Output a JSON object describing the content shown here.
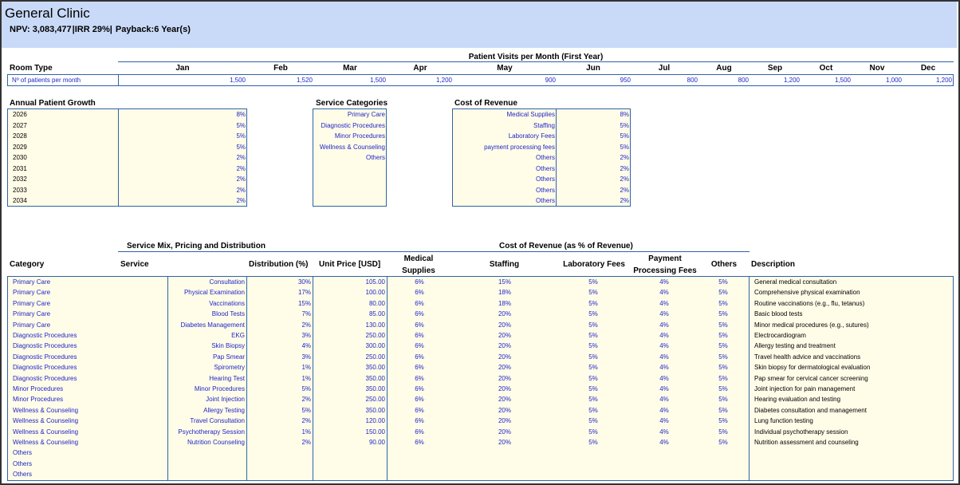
{
  "header": {
    "title": "General Clinic",
    "npv": "NPV: 3,083,477",
    "irr": "|IRR 29%|",
    "payback": "Payback:6 Year(s)"
  },
  "visits": {
    "section_title": "Patient Visits per Month (First Year)",
    "room_type_label": "Room Type",
    "row_label": "Nº of patients per month",
    "months": [
      "Jan",
      "Feb",
      "Mar",
      "Apr",
      "May",
      "Jun",
      "Jul",
      "Aug",
      "Sep",
      "Oct",
      "Nov",
      "Dec"
    ],
    "values": [
      "1,500",
      "1,520",
      "1,500",
      "1,200",
      "900",
      "950",
      "800",
      "800",
      "1,200",
      "1,500",
      "1,000",
      "1,200"
    ]
  },
  "growth": {
    "title": "Annual Patient Growth",
    "rows": [
      {
        "year": "2026",
        "value": "8%"
      },
      {
        "year": "2027",
        "value": "5%"
      },
      {
        "year": "2028",
        "value": "5%"
      },
      {
        "year": "2029",
        "value": "5%"
      },
      {
        "year": "2030",
        "value": "2%"
      },
      {
        "year": "2031",
        "value": "2%"
      },
      {
        "year": "2032",
        "value": "2%"
      },
      {
        "year": "2033",
        "value": "2%"
      },
      {
        "year": "2034",
        "value": "2%"
      }
    ]
  },
  "service_categories": {
    "title": "Service Categories",
    "items": [
      "Primary Care",
      "Diagnostic Procedures",
      "Minor Procedures",
      "Wellness & Counseling",
      "Others"
    ]
  },
  "cost_of_revenue": {
    "title": "Cost of Revenue",
    "rows": [
      {
        "label": "Medical Supplies",
        "value": "8%"
      },
      {
        "label": "Staffing",
        "value": "5%"
      },
      {
        "label": "Laboratory Fees",
        "value": "5%"
      },
      {
        "label": "payment processing fees",
        "value": "5%"
      },
      {
        "label": "Others",
        "value": "2%"
      },
      {
        "label": "Others",
        "value": "2%"
      },
      {
        "label": "Others",
        "value": "2%"
      },
      {
        "label": "Others",
        "value": "2%"
      },
      {
        "label": "Others",
        "value": "2%"
      }
    ]
  },
  "mix": {
    "group1_title": "Service Mix, Pricing and Distribution",
    "group2_title": "Cost of Revenue (as % of Revenue)",
    "headers": {
      "category": "Category",
      "service": "Service",
      "distribution": "Distribution (%)",
      "unit_price": "Unit Price [USD]",
      "medical_1": "Medical",
      "medical_2": "Supplies",
      "staffing": "Staffing",
      "lab": "Laboratory Fees",
      "payment_1": "Payment",
      "payment_2": "Processing Fees",
      "others": "Others",
      "description": "Description"
    },
    "rows": [
      {
        "category": "Primary Care",
        "service": "Consultation",
        "dist": "30%",
        "price": "105.00",
        "med": "6%",
        "staff": "15%",
        "lab": "5%",
        "pay": "4%",
        "oth": "5%",
        "desc": "General medical consultation"
      },
      {
        "category": "Primary Care",
        "service": "Physical Examination",
        "dist": "17%",
        "price": "100.00",
        "med": "6%",
        "staff": "18%",
        "lab": "5%",
        "pay": "4%",
        "oth": "5%",
        "desc": "Comprehensive physical examination"
      },
      {
        "category": "Primary Care",
        "service": "Vaccinations",
        "dist": "15%",
        "price": "80.00",
        "med": "6%",
        "staff": "18%",
        "lab": "5%",
        "pay": "4%",
        "oth": "5%",
        "desc": "Routine vaccinations (e.g., flu, tetanus)"
      },
      {
        "category": "Primary Care",
        "service": "Blood Tests",
        "dist": "7%",
        "price": "85.00",
        "med": "6%",
        "staff": "20%",
        "lab": "5%",
        "pay": "4%",
        "oth": "5%",
        "desc": "Basic blood tests"
      },
      {
        "category": "Primary Care",
        "service": "Diabetes Management",
        "dist": "2%",
        "price": "130.00",
        "med": "6%",
        "staff": "20%",
        "lab": "5%",
        "pay": "4%",
        "oth": "5%",
        "desc": "Minor medical procedures (e.g., sutures)"
      },
      {
        "category": "Diagnostic Procedures",
        "service": "EKG",
        "dist": "3%",
        "price": "250.00",
        "med": "6%",
        "staff": "20%",
        "lab": "5%",
        "pay": "4%",
        "oth": "5%",
        "desc": "Electrocardiogram"
      },
      {
        "category": "Diagnostic Procedures",
        "service": "Skin Biopsy",
        "dist": "4%",
        "price": "300.00",
        "med": "6%",
        "staff": "20%",
        "lab": "5%",
        "pay": "4%",
        "oth": "5%",
        "desc": "Allergy testing and treatment"
      },
      {
        "category": "Diagnostic Procedures",
        "service": "Pap Smear",
        "dist": "3%",
        "price": "250.00",
        "med": "6%",
        "staff": "20%",
        "lab": "5%",
        "pay": "4%",
        "oth": "5%",
        "desc": "Travel health advice and vaccinations"
      },
      {
        "category": "Diagnostic Procedures",
        "service": "Spirometry",
        "dist": "1%",
        "price": "350.00",
        "med": "6%",
        "staff": "20%",
        "lab": "5%",
        "pay": "4%",
        "oth": "5%",
        "desc": "Skin biopsy for dermatological evaluation"
      },
      {
        "category": "Diagnostic Procedures",
        "service": "Hearing Test",
        "dist": "1%",
        "price": "350.00",
        "med": "6%",
        "staff": "20%",
        "lab": "5%",
        "pay": "4%",
        "oth": "5%",
        "desc": "Pap smear for cervical cancer screening"
      },
      {
        "category": "Minor Procedures",
        "service": "Minor Procedures",
        "dist": "5%",
        "price": "350.00",
        "med": "6%",
        "staff": "20%",
        "lab": "5%",
        "pay": "4%",
        "oth": "5%",
        "desc": "Joint injection for pain management"
      },
      {
        "category": "Minor Procedures",
        "service": "Joint Injection",
        "dist": "2%",
        "price": "250.00",
        "med": "6%",
        "staff": "20%",
        "lab": "5%",
        "pay": "4%",
        "oth": "5%",
        "desc": "Hearing evaluation and testing"
      },
      {
        "category": "Wellness & Counseling",
        "service": "Allergy Testing",
        "dist": "5%",
        "price": "350.00",
        "med": "6%",
        "staff": "20%",
        "lab": "5%",
        "pay": "4%",
        "oth": "5%",
        "desc": "Diabetes consultation and management"
      },
      {
        "category": "Wellness & Counseling",
        "service": "Travel Consultation",
        "dist": "2%",
        "price": "120.00",
        "med": "6%",
        "staff": "20%",
        "lab": "5%",
        "pay": "4%",
        "oth": "5%",
        "desc": "Lung function testing"
      },
      {
        "category": "Wellness & Counseling",
        "service": "Psychotherapy Session",
        "dist": "1%",
        "price": "150.00",
        "med": "6%",
        "staff": "20%",
        "lab": "5%",
        "pay": "4%",
        "oth": "5%",
        "desc": "Individual psychotherapy session"
      },
      {
        "category": "Wellness & Counseling",
        "service": "Nutrition Counseling",
        "dist": "2%",
        "price": "90.00",
        "med": "6%",
        "staff": "20%",
        "lab": "5%",
        "pay": "4%",
        "oth": "5%",
        "desc": "Nutrition assessment and counseling"
      },
      {
        "category": "Others",
        "service": "",
        "dist": "",
        "price": "",
        "med": "",
        "staff": "",
        "lab": "",
        "pay": "",
        "oth": "",
        "desc": ""
      },
      {
        "category": "Others",
        "service": "",
        "dist": "",
        "price": "",
        "med": "",
        "staff": "",
        "lab": "",
        "pay": "",
        "oth": "",
        "desc": ""
      },
      {
        "category": "Others",
        "service": "",
        "dist": "",
        "price": "",
        "med": "",
        "staff": "",
        "lab": "",
        "pay": "",
        "oth": "",
        "desc": ""
      }
    ]
  }
}
